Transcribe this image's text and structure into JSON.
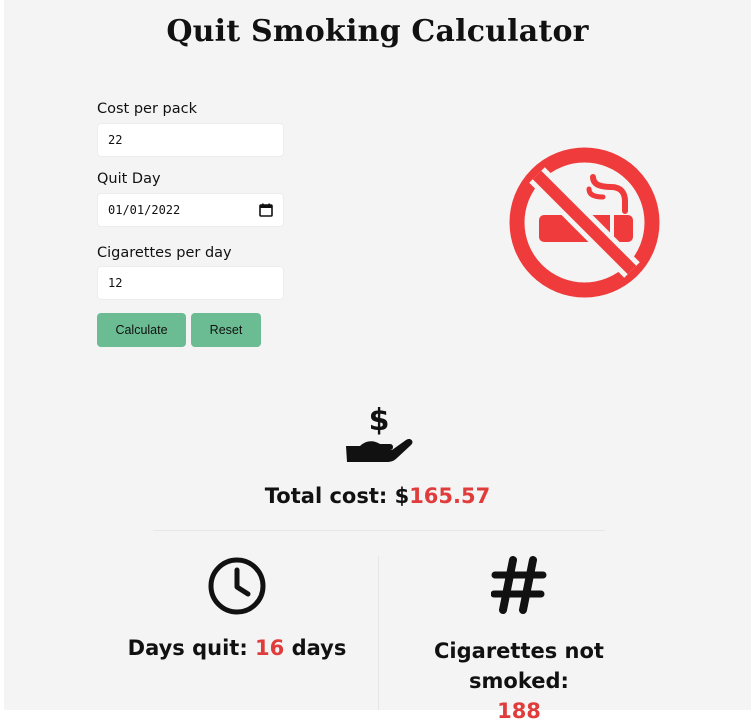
{
  "title": "Quit Smoking Calculator",
  "form": {
    "cost_label": "Cost per pack",
    "cost_value": "22",
    "quit_day_label": "Quit Day",
    "quit_day_value": "01/01/2022",
    "cigs_label": "Cigarettes per day",
    "cigs_value": "12",
    "calculate_label": "Calculate",
    "reset_label": "Reset"
  },
  "results": {
    "total_cost_label": "Total cost: $",
    "total_cost_value": "165.57",
    "days_quit_label": "Days quit: ",
    "days_quit_value": "16",
    "days_quit_unit": " days",
    "not_smoked_label": "Cigarettes not smoked:",
    "not_smoked_value": "188"
  },
  "icons": {
    "no_smoking": "no-smoking-icon",
    "money_hand": "hand-holding-dollar-icon",
    "clock": "clock-icon",
    "hashtag": "hashtag-icon",
    "calendar": "calendar-icon"
  },
  "colors": {
    "accent_red": "#e03c3c",
    "button_green": "#6bbc93",
    "icon_red": "#ef3b3b"
  }
}
